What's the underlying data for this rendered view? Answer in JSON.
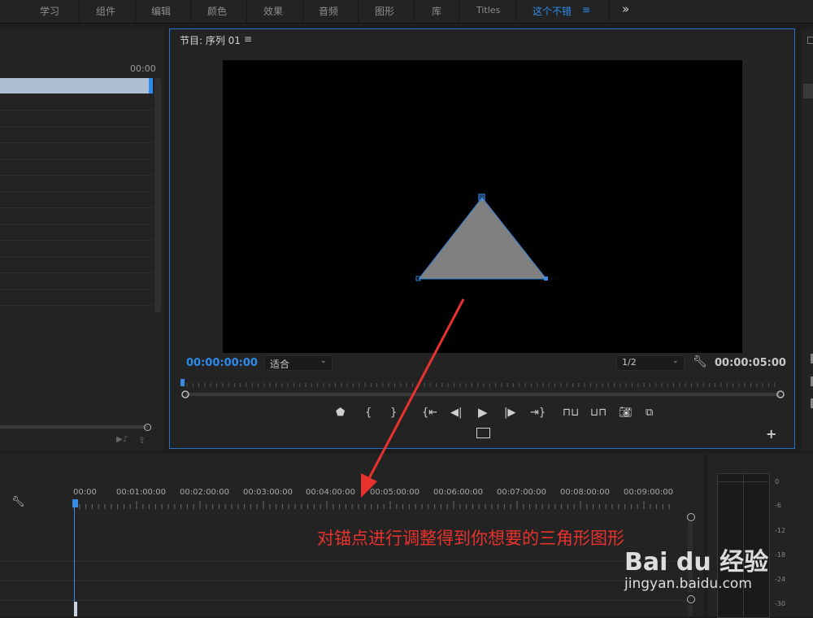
{
  "workspaces": [
    "学习",
    "组件",
    "编辑",
    "颜色",
    "效果",
    "音频",
    "图形",
    "库",
    "Titles",
    "这个不错"
  ],
  "workspace_menu_icon": "≡",
  "more_icon": "»",
  "left_panel": {
    "timecode": "00:00"
  },
  "program_monitor": {
    "title": "节目: 序列 01",
    "menu_icon": "≡",
    "current_timecode": "00:00:00:00",
    "zoom_label": "适合",
    "resolution_label": "1/2",
    "duration_timecode": "00:00:05:00"
  },
  "timeline": {
    "ruler": [
      "00:00",
      "00:01:00:00",
      "00:02:00:00",
      "00:03:00:00",
      "00:04:00:00",
      "00:05:00:00",
      "00:06:00:00",
      "00:07:00:00",
      "00:08:00:00",
      "00:09:00:00"
    ]
  },
  "audio_meter": {
    "scale": [
      "0",
      "-6",
      "-12",
      "-18",
      "-24",
      "-30"
    ]
  },
  "annotation": {
    "text": "对锚点进行调整得到你想要的三角形图形",
    "color": "#e8322d"
  },
  "watermark": {
    "brand": "Bai du 经验",
    "url": "jingyan.baidu.com"
  },
  "colors": {
    "accent": "#2d8ceb",
    "shape_fill": "#808080",
    "panel": "#232323"
  }
}
